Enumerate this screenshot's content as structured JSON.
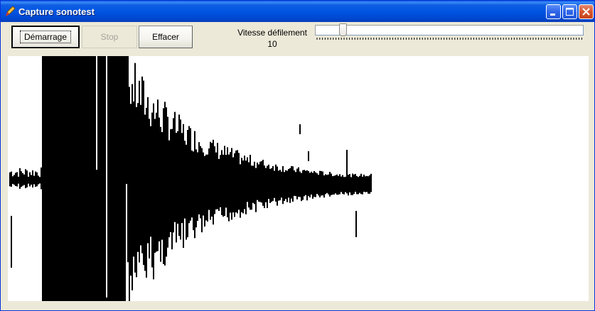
{
  "window": {
    "title": "Capture sonotest"
  },
  "toolbar": {
    "start_label": "Démarrage",
    "stop_label": "Stop",
    "clear_label": "Effacer",
    "stop_enabled": false
  },
  "speed": {
    "label": "Vitesse défilement",
    "value": "10",
    "slider_fraction": 0.1
  },
  "colors": {
    "titlebar": "#0053e1",
    "waveform": "#000000",
    "canvas": "#ffffff",
    "face": "#ece9d8"
  }
}
